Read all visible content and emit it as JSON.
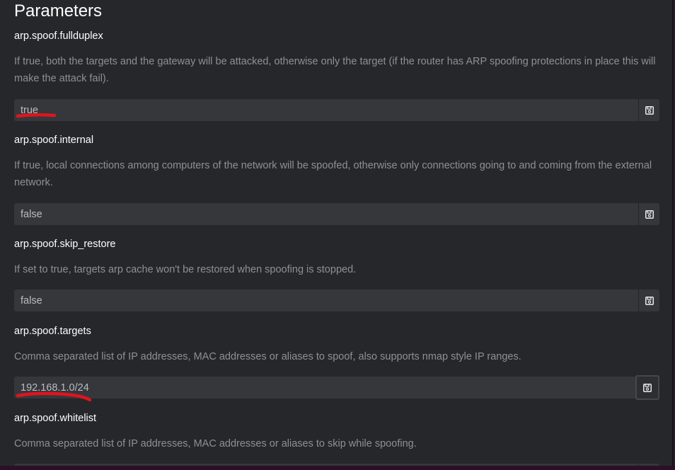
{
  "heading": "Parameters",
  "params": [
    {
      "name": "arp.spoof.fullduplex",
      "description": "If true, both the targets and the gateway will be attacked, otherwise only the target (if the router has ARP spoofing protections in place this will make the attack fail).",
      "value": "true"
    },
    {
      "name": "arp.spoof.internal",
      "description": "If true, local connections among computers of the network will be spoofed, otherwise only connections going to and coming from the external network.",
      "value": "false"
    },
    {
      "name": "arp.spoof.skip_restore",
      "description": "If set to true, targets arp cache won't be restored when spoofing is stopped.",
      "value": "false"
    },
    {
      "name": "arp.spoof.targets",
      "description": "Comma separated list of IP addresses, MAC addresses or aliases to spoof, also supports nmap style IP ranges.",
      "value": "192.168.1.0/24"
    },
    {
      "name": "arp.spoof.whitelist",
      "description": "Comma separated list of IP addresses, MAC addresses or aliases to skip while spoofing.",
      "value": ""
    }
  ],
  "icons": {
    "save": "floppy-disk-icon"
  },
  "colors": {
    "background": "#26272b",
    "field": "#36373b",
    "text": "#ffffff",
    "muted": "#8c9096",
    "annotation": "#e0141e"
  }
}
